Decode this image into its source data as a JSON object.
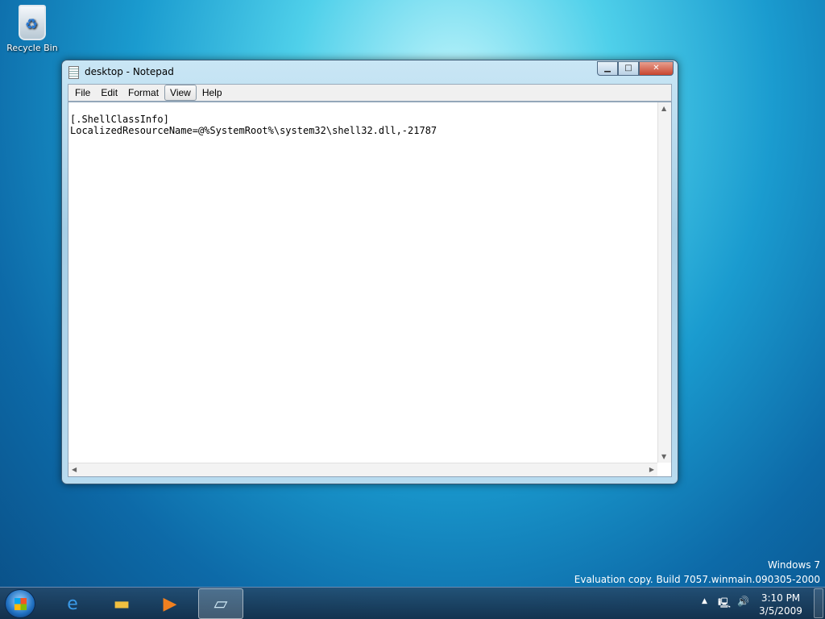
{
  "desktop": {
    "icons": [
      {
        "label": "Recycle Bin",
        "icon": "recycle-bin-icon"
      }
    ],
    "watermark": {
      "line1": "Windows 7",
      "line2": "Evaluation copy. Build 7057.winmain.090305-2000"
    }
  },
  "window": {
    "title": "desktop - Notepad",
    "menu": [
      "File",
      "Edit",
      "Format",
      "View",
      "Help"
    ],
    "content": {
      "line1": "[.ShellClassInfo]",
      "line2": "LocalizedResourceName=@%SystemRoot%\\system32\\shell32.dll,-21787"
    }
  },
  "taskbar": {
    "pinned": [
      "Internet Explorer",
      "Windows Explorer",
      "Windows Media Player",
      "Notepad"
    ],
    "clock": {
      "time": "3:10 PM",
      "date": "3/5/2009"
    }
  }
}
